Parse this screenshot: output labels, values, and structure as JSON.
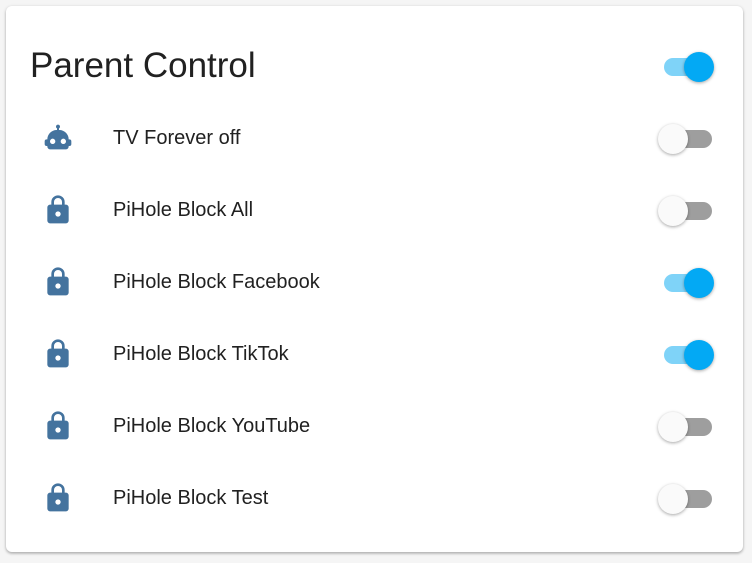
{
  "card": {
    "title": "Parent Control",
    "master_toggle_on": true
  },
  "colors": {
    "accent": "#03a9f4",
    "accent_track": "#7fd3f8",
    "off_track": "#9e9e9e",
    "icon": "#44739e"
  },
  "entities": [
    {
      "label": "TV Forever off",
      "icon": "robot-icon",
      "on": false
    },
    {
      "label": "PiHole Block All",
      "icon": "lock-icon",
      "on": false
    },
    {
      "label": "PiHole Block Facebook",
      "icon": "lock-icon",
      "on": true
    },
    {
      "label": "PiHole Block TikTok",
      "icon": "lock-icon",
      "on": true
    },
    {
      "label": "PiHole Block YouTube",
      "icon": "lock-icon",
      "on": false
    },
    {
      "label": "PiHole Block Test",
      "icon": "lock-icon",
      "on": false
    }
  ]
}
